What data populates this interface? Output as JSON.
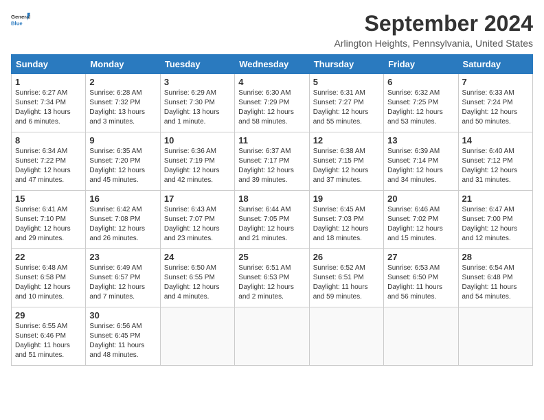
{
  "logo": {
    "text_general": "General",
    "text_blue": "Blue"
  },
  "title": "September 2024",
  "location": "Arlington Heights, Pennsylvania, United States",
  "days_of_week": [
    "Sunday",
    "Monday",
    "Tuesday",
    "Wednesday",
    "Thursday",
    "Friday",
    "Saturday"
  ],
  "weeks": [
    [
      {
        "day": "1",
        "sunrise": "Sunrise: 6:27 AM",
        "sunset": "Sunset: 7:34 PM",
        "daylight": "Daylight: 13 hours and 6 minutes."
      },
      {
        "day": "2",
        "sunrise": "Sunrise: 6:28 AM",
        "sunset": "Sunset: 7:32 PM",
        "daylight": "Daylight: 13 hours and 3 minutes."
      },
      {
        "day": "3",
        "sunrise": "Sunrise: 6:29 AM",
        "sunset": "Sunset: 7:30 PM",
        "daylight": "Daylight: 13 hours and 1 minute."
      },
      {
        "day": "4",
        "sunrise": "Sunrise: 6:30 AM",
        "sunset": "Sunset: 7:29 PM",
        "daylight": "Daylight: 12 hours and 58 minutes."
      },
      {
        "day": "5",
        "sunrise": "Sunrise: 6:31 AM",
        "sunset": "Sunset: 7:27 PM",
        "daylight": "Daylight: 12 hours and 55 minutes."
      },
      {
        "day": "6",
        "sunrise": "Sunrise: 6:32 AM",
        "sunset": "Sunset: 7:25 PM",
        "daylight": "Daylight: 12 hours and 53 minutes."
      },
      {
        "day": "7",
        "sunrise": "Sunrise: 6:33 AM",
        "sunset": "Sunset: 7:24 PM",
        "daylight": "Daylight: 12 hours and 50 minutes."
      }
    ],
    [
      {
        "day": "8",
        "sunrise": "Sunrise: 6:34 AM",
        "sunset": "Sunset: 7:22 PM",
        "daylight": "Daylight: 12 hours and 47 minutes."
      },
      {
        "day": "9",
        "sunrise": "Sunrise: 6:35 AM",
        "sunset": "Sunset: 7:20 PM",
        "daylight": "Daylight: 12 hours and 45 minutes."
      },
      {
        "day": "10",
        "sunrise": "Sunrise: 6:36 AM",
        "sunset": "Sunset: 7:19 PM",
        "daylight": "Daylight: 12 hours and 42 minutes."
      },
      {
        "day": "11",
        "sunrise": "Sunrise: 6:37 AM",
        "sunset": "Sunset: 7:17 PM",
        "daylight": "Daylight: 12 hours and 39 minutes."
      },
      {
        "day": "12",
        "sunrise": "Sunrise: 6:38 AM",
        "sunset": "Sunset: 7:15 PM",
        "daylight": "Daylight: 12 hours and 37 minutes."
      },
      {
        "day": "13",
        "sunrise": "Sunrise: 6:39 AM",
        "sunset": "Sunset: 7:14 PM",
        "daylight": "Daylight: 12 hours and 34 minutes."
      },
      {
        "day": "14",
        "sunrise": "Sunrise: 6:40 AM",
        "sunset": "Sunset: 7:12 PM",
        "daylight": "Daylight: 12 hours and 31 minutes."
      }
    ],
    [
      {
        "day": "15",
        "sunrise": "Sunrise: 6:41 AM",
        "sunset": "Sunset: 7:10 PM",
        "daylight": "Daylight: 12 hours and 29 minutes."
      },
      {
        "day": "16",
        "sunrise": "Sunrise: 6:42 AM",
        "sunset": "Sunset: 7:08 PM",
        "daylight": "Daylight: 12 hours and 26 minutes."
      },
      {
        "day": "17",
        "sunrise": "Sunrise: 6:43 AM",
        "sunset": "Sunset: 7:07 PM",
        "daylight": "Daylight: 12 hours and 23 minutes."
      },
      {
        "day": "18",
        "sunrise": "Sunrise: 6:44 AM",
        "sunset": "Sunset: 7:05 PM",
        "daylight": "Daylight: 12 hours and 21 minutes."
      },
      {
        "day": "19",
        "sunrise": "Sunrise: 6:45 AM",
        "sunset": "Sunset: 7:03 PM",
        "daylight": "Daylight: 12 hours and 18 minutes."
      },
      {
        "day": "20",
        "sunrise": "Sunrise: 6:46 AM",
        "sunset": "Sunset: 7:02 PM",
        "daylight": "Daylight: 12 hours and 15 minutes."
      },
      {
        "day": "21",
        "sunrise": "Sunrise: 6:47 AM",
        "sunset": "Sunset: 7:00 PM",
        "daylight": "Daylight: 12 hours and 12 minutes."
      }
    ],
    [
      {
        "day": "22",
        "sunrise": "Sunrise: 6:48 AM",
        "sunset": "Sunset: 6:58 PM",
        "daylight": "Daylight: 12 hours and 10 minutes."
      },
      {
        "day": "23",
        "sunrise": "Sunrise: 6:49 AM",
        "sunset": "Sunset: 6:57 PM",
        "daylight": "Daylight: 12 hours and 7 minutes."
      },
      {
        "day": "24",
        "sunrise": "Sunrise: 6:50 AM",
        "sunset": "Sunset: 6:55 PM",
        "daylight": "Daylight: 12 hours and 4 minutes."
      },
      {
        "day": "25",
        "sunrise": "Sunrise: 6:51 AM",
        "sunset": "Sunset: 6:53 PM",
        "daylight": "Daylight: 12 hours and 2 minutes."
      },
      {
        "day": "26",
        "sunrise": "Sunrise: 6:52 AM",
        "sunset": "Sunset: 6:51 PM",
        "daylight": "Daylight: 11 hours and 59 minutes."
      },
      {
        "day": "27",
        "sunrise": "Sunrise: 6:53 AM",
        "sunset": "Sunset: 6:50 PM",
        "daylight": "Daylight: 11 hours and 56 minutes."
      },
      {
        "day": "28",
        "sunrise": "Sunrise: 6:54 AM",
        "sunset": "Sunset: 6:48 PM",
        "daylight": "Daylight: 11 hours and 54 minutes."
      }
    ],
    [
      {
        "day": "29",
        "sunrise": "Sunrise: 6:55 AM",
        "sunset": "Sunset: 6:46 PM",
        "daylight": "Daylight: 11 hours and 51 minutes."
      },
      {
        "day": "30",
        "sunrise": "Sunrise: 6:56 AM",
        "sunset": "Sunset: 6:45 PM",
        "daylight": "Daylight: 11 hours and 48 minutes."
      },
      null,
      null,
      null,
      null,
      null
    ]
  ]
}
